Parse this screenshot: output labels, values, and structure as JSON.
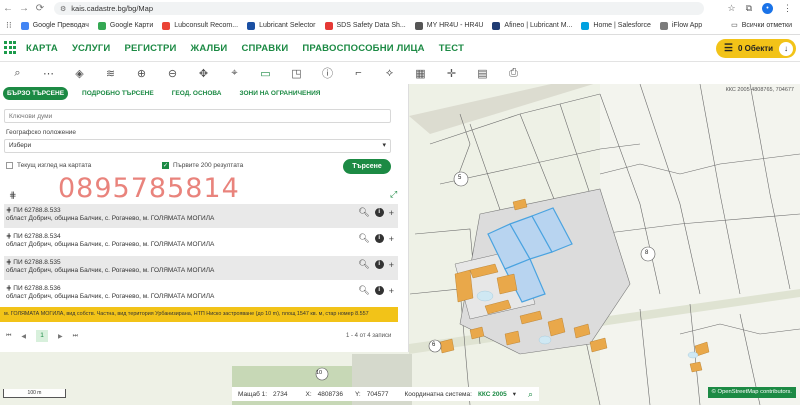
{
  "browser": {
    "url": "kais.cadastre.bg/bg/Map",
    "profile_initial": "•",
    "bookmarks": [
      {
        "label": "Google Преводач",
        "color": "#4285f4"
      },
      {
        "label": "Google Карти",
        "color": "#34a853"
      },
      {
        "label": "Lubconsult Recom...",
        "color": "#ea4335"
      },
      {
        "label": "Lubricant Selector",
        "color": "#1a4fa3"
      },
      {
        "label": "SDS Safety Data Sh...",
        "color": "#e53935"
      },
      {
        "label": "MY HR4U - HR4U",
        "color": "#555555"
      },
      {
        "label": "Afineo | Lubricant M...",
        "color": "#1f3b73"
      },
      {
        "label": "Home | Salesforce",
        "color": "#00a1e0"
      },
      {
        "label": "iFlow App",
        "color": "#7b7b7b"
      }
    ],
    "all_bookmarks_label": "Всички отметки"
  },
  "menu": {
    "items": [
      "КАРТА",
      "УСЛУГИ",
      "РЕГИСТРИ",
      "ЖАЛБИ",
      "СПРАВКИ",
      "ПРАВОСПОСОБНИ ЛИЦА",
      "ТЕСТ"
    ],
    "objects_button": "0 Обекти"
  },
  "toolbar": {
    "tools": [
      "search-icon",
      "measure-line-icon",
      "layers-icon",
      "layers-stack-icon",
      "zoom-in-icon",
      "zoom-out-icon",
      "pan-icon",
      "marker-icon",
      "select-rectangle-icon",
      "select-polygon-icon",
      "info-icon",
      "corner-icon",
      "route-icon",
      "map-icon",
      "crosshair-icon",
      "document-icon",
      "print-icon"
    ]
  },
  "panel": {
    "tabs": [
      "БЪРЗО ТЪРСЕНЕ",
      "ПОДРОБНО ТЪРСЕНЕ",
      "ГЕОД. ОСНОВА",
      "ЗОНИ НА ОГРАНИЧЕНИЯ"
    ],
    "keywords_placeholder": "Ключови думи",
    "geo_label": "Географско положение",
    "geo_value": "Избери",
    "current_view_label": "Текущ изглед на картата",
    "first200_label": "Първите 200 резултата",
    "search_button": "Търсене",
    "watermark": "0895785814",
    "results": [
      {
        "title": "ПИ 62788.8.533",
        "sub": "област Добрич, община Балчик, с. Рогачево, м. ГОЛЯМАТА МОГИЛА"
      },
      {
        "title": "ПИ 62788.8.534",
        "sub": "област Добрич, община Балчик, с. Рогачево, м. ГОЛЯМАТА МОГИЛА"
      },
      {
        "title": "ПИ 62788.8.535",
        "sub": "област Добрич, община Балчик, с. Рогачево, м. ГОЛЯМАТА МОГИЛА"
      },
      {
        "title": "ПИ 62788.8.536",
        "sub": "област Добрич, община Балчик, с. Рогачево, м. ГОЛЯМАТА МОГИЛА"
      }
    ],
    "highlight": "м. ГОЛЯМАТА МОГИЛА, вид собств. Частна, вид територия Урбанизирана, НТП Ниско застрояване (до 10 m), площ 1547 кв. м, стар номер 8.557",
    "pager_page": "1",
    "pager_info": "1 - 4 от 4 записи"
  },
  "map": {
    "coord_badge": "ККС 2005 4808765, 704677",
    "labels": [
      "6",
      "8",
      "10",
      "5"
    ],
    "scale": "100 m",
    "osm": "© OpenStreetMap contributors."
  },
  "status": {
    "scale_label": "Мащаб 1:",
    "scale_value": "2734",
    "x_label": "X:",
    "x_value": "4808736",
    "y_label": "Y:",
    "y_value": "704577",
    "crs_label": "Координатна система:",
    "crs_value": "ККС 2005"
  },
  "colors": {
    "accent": "#1c8a44",
    "highlight": "#f2c318",
    "selected_parcel": "#4aa3e0"
  }
}
